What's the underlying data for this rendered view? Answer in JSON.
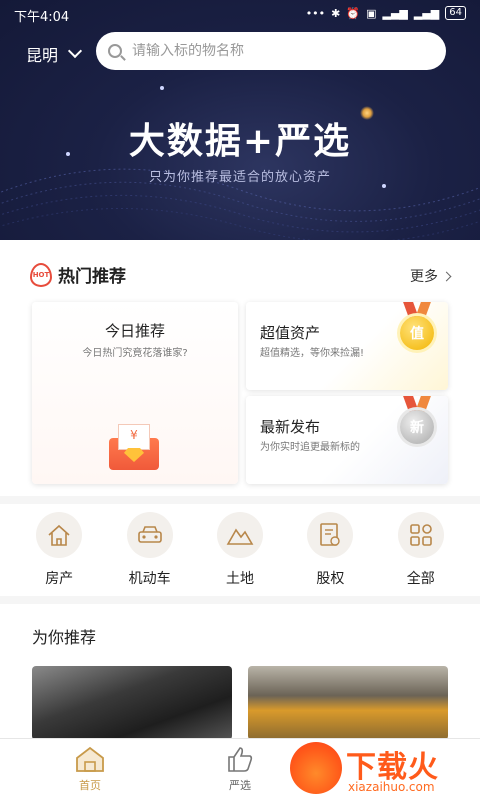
{
  "status_bar": {
    "time": "下午4:04",
    "battery": "64"
  },
  "header": {
    "city": "昆明",
    "search_placeholder": "请输入标的物名称"
  },
  "banner": {
    "title": "大数据+严选",
    "subtitle": "只为你推荐最适合的放心资产"
  },
  "hot": {
    "badge": "HOT",
    "title": "热门推荐",
    "more_label": "更多",
    "today": {
      "title": "今日推荐",
      "subtitle": "今日热门究竟花落谁家?",
      "paper_symbol": "¥"
    },
    "value": {
      "title": "超值资产",
      "subtitle": "超值精选，等你来捡漏!",
      "medal": "值"
    },
    "latest": {
      "title": "最新发布",
      "subtitle": "为你实时追更最新标的",
      "medal": "新"
    }
  },
  "categories": [
    {
      "label": "房产",
      "icon": "house-icon"
    },
    {
      "label": "机动车",
      "icon": "car-icon"
    },
    {
      "label": "土地",
      "icon": "mountain-icon"
    },
    {
      "label": "股权",
      "icon": "certificate-icon"
    },
    {
      "label": "全部",
      "icon": "grid-icon"
    }
  ],
  "recommend": {
    "title": "为你推荐"
  },
  "tabbar": {
    "home_label": "首页",
    "select_label": "严选"
  },
  "watermark": {
    "text": "下载火",
    "url": "xiazaihuo.com"
  },
  "colors": {
    "accent": "#c89a4a",
    "hot_red": "#e74c3c",
    "banner_bg": "#1b2145"
  }
}
